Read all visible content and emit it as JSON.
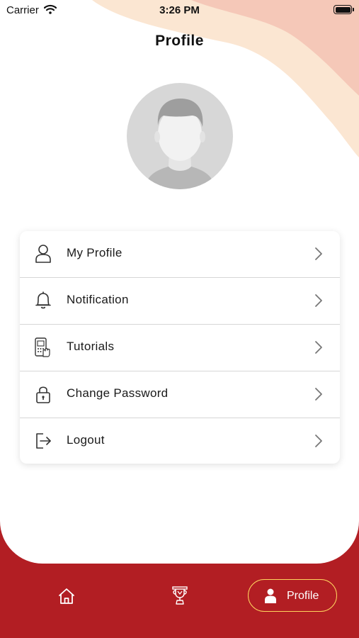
{
  "status_bar": {
    "carrier": "Carrier",
    "time": "3:26 PM"
  },
  "header": {
    "title": "Profile"
  },
  "menu": {
    "items": [
      {
        "label": "My Profile",
        "icon": "user-icon"
      },
      {
        "label": "Notification",
        "icon": "bell-icon"
      },
      {
        "label": "Tutorials",
        "icon": "tutorial-phone-icon"
      },
      {
        "label": "Change Password",
        "icon": "lock-icon"
      },
      {
        "label": "Logout",
        "icon": "logout-icon"
      }
    ]
  },
  "bottom_nav": {
    "items": [
      {
        "icon": "home-icon"
      },
      {
        "icon": "trophy-icon"
      },
      {
        "icon": "person-icon",
        "label": "Profile",
        "active": true
      }
    ]
  },
  "colors": {
    "brand_red": "#b21e23",
    "accent_yellow": "#ffd45e",
    "blob_peach": "#f5c8b8",
    "blob_cream": "#fbe6d2"
  }
}
